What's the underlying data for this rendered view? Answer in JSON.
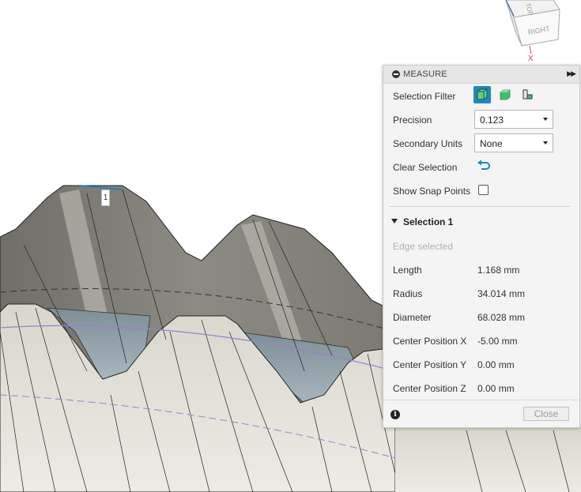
{
  "viewcube": {
    "face_right": "RIGHT",
    "face_top": "TOP",
    "axis_x": "X"
  },
  "edge_marker": "1",
  "panel": {
    "title": "MEASURE",
    "selection_filter": {
      "label": "Selection Filter",
      "options": [
        "body-filter-icon",
        "face-filter-icon",
        "point-filter-icon"
      ],
      "active": 0
    },
    "precision": {
      "label": "Precision",
      "value": "0.123"
    },
    "secondary_units": {
      "label": "Secondary Units",
      "value": "None"
    },
    "clear_selection": {
      "label": "Clear Selection"
    },
    "show_snap_points": {
      "label": "Show Snap Points",
      "checked": false
    },
    "section": {
      "title": "Selection 1",
      "hint": "Edge selected"
    },
    "measurements": [
      {
        "label": "Length",
        "value": "1.168 mm"
      },
      {
        "label": "Radius",
        "value": "34.014 mm"
      },
      {
        "label": "Diameter",
        "value": "68.028 mm"
      },
      {
        "label": "Center Position X",
        "value": "-5.00 mm"
      },
      {
        "label": "Center Position Y",
        "value": "0.00 mm"
      },
      {
        "label": "Center Position Z",
        "value": "0.00 mm"
      }
    ],
    "close_label": "Close"
  },
  "colors": {
    "accent": "#1e87c8",
    "gear_face": "#e4e2d8",
    "gear_flank": "#8a8a84",
    "sketch_line": "#9b7fd0"
  }
}
